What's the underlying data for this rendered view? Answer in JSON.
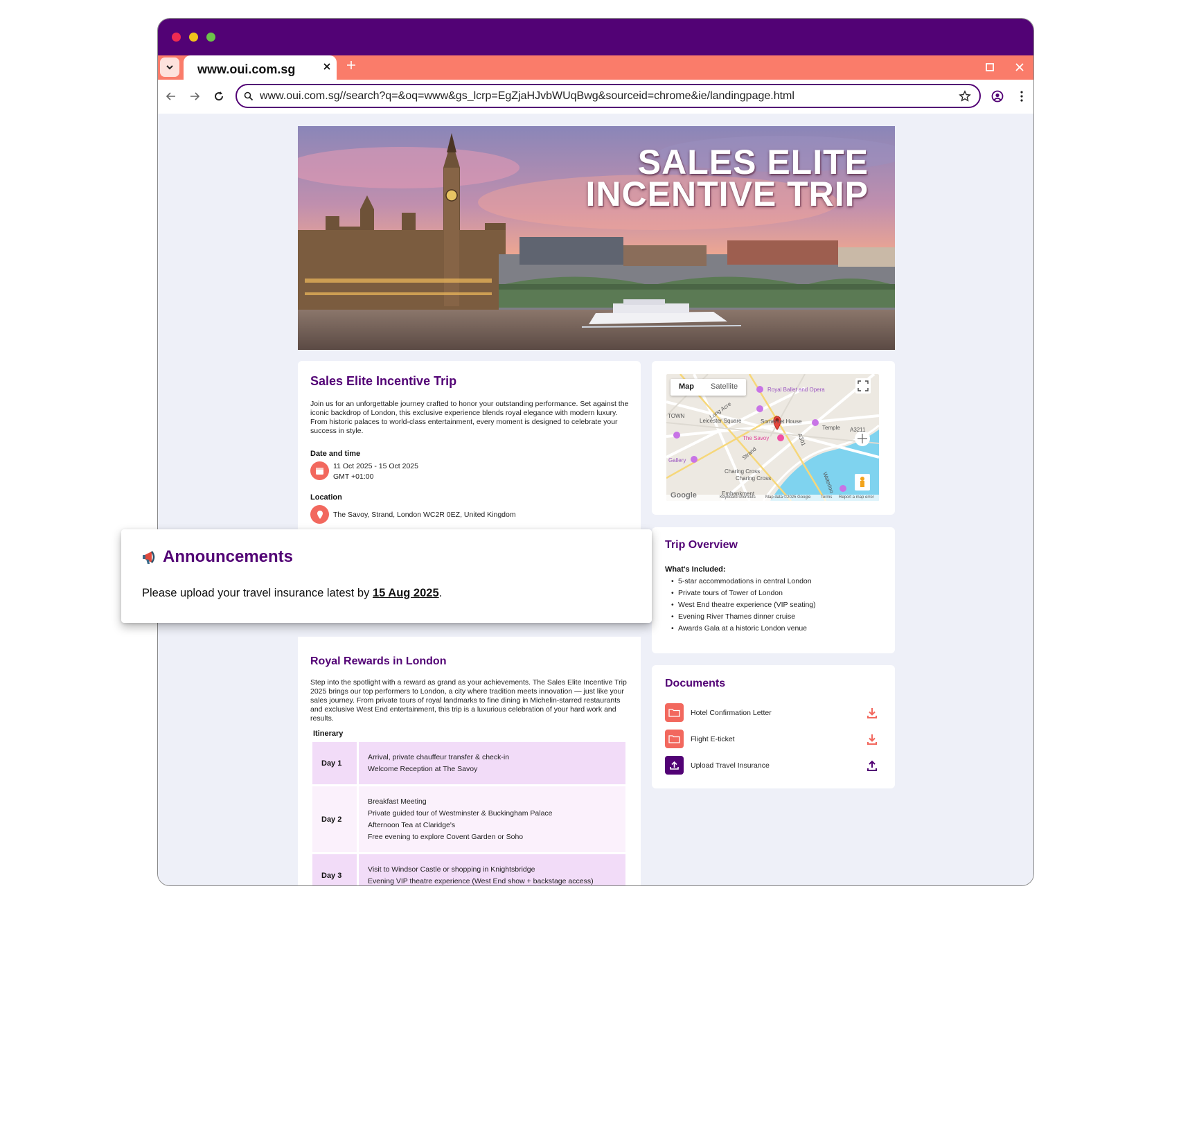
{
  "browser": {
    "tab_title": "www.oui.com.sg",
    "url": "www.oui.com.sg//search?q=&oq=www&gs_lcrp=EgZjaHJvbWUqBwg&sourceid=chrome&ie/landingpage.html"
  },
  "colors": {
    "brand": "#520275",
    "tabbar": "#fa7c6a",
    "accent": "#f2685e",
    "page_bg": "#eef0f8"
  },
  "hero": {
    "title_line1": "SALES ELITE",
    "title_line2": "INCENTIVE TRIP"
  },
  "event": {
    "title": "Sales Elite Incentive Trip",
    "description": "Join us for an unforgettable journey crafted to honor your outstanding performance. Set against the iconic backdrop of London, this exclusive experience blends royal elegance with modern luxury. From historic palaces to world-class entertainment, every moment is designed to celebrate your success in style.",
    "date_label": "Date and time",
    "date_range": "11 Oct 2025 - 15 Oct 2025",
    "timezone": "GMT +01:00",
    "location_label": "Location",
    "location": "The Savoy, Strand, London WC2R 0EZ, United Kingdom"
  },
  "map": {
    "tab_map": "Map",
    "tab_satellite": "Satellite",
    "labels": {
      "royal_ballet": "Royal Ballet and Opera",
      "leicester": "Leicester Square",
      "somerset": "Somerset House",
      "temple": "Temple",
      "a3211": "A3211",
      "savoy": "The Savoy",
      "gallery": "Gallery",
      "strand": "Strand",
      "charing_cross": "Charing Cross",
      "charing_cross2": "Charing Cross",
      "embankment": "Embankment",
      "a301": "A301",
      "waterloo": "Waterloo",
      "long_acre": "Long Acre",
      "town": "TOWN"
    },
    "google": "Google",
    "footer_shortcuts": "Keyboard shortcuts",
    "footer_data": "Map data ©2025 Google",
    "footer_terms": "Terms",
    "footer_report": "Report a map error"
  },
  "announcement": {
    "title": "Announcements",
    "text_before": "Please upload your travel insurance latest by",
    "deadline": "15 Aug 2025",
    "text_after": "."
  },
  "overview": {
    "title": "Trip Overview",
    "included_label": "What's Included:",
    "items": [
      "5-star accommodations in central London",
      "Private tours of Tower of London",
      "West End theatre experience (VIP seating)",
      "Evening River Thames dinner cruise",
      "Awards Gala at a historic London venue"
    ]
  },
  "documents": {
    "title": "Documents",
    "items": [
      {
        "name": "Hotel Confirmation Letter",
        "icon": "folder-icon",
        "action": "download-icon"
      },
      {
        "name": "Flight E-ticket",
        "icon": "folder-icon",
        "action": "download-icon"
      },
      {
        "name": "Upload Travel Insurance",
        "icon": "upload-icon",
        "action": "upload-icon"
      }
    ]
  },
  "rewards": {
    "title": "Royal Rewards in London",
    "description": "Step into the spotlight with a reward as grand as your achievements. The Sales Elite Incentive Trip 2025 brings our top performers to London, a city where tradition meets innovation — just like your sales journey. From private tours of royal landmarks to fine dining in Michelin-starred restaurants and exclusive West End entertainment, this trip is a luxurious celebration of your hard work and results.",
    "itinerary_label": "Itinerary",
    "days": [
      {
        "day": "Day 1",
        "activities": [
          "Arrival, private chauffeur transfer & check-in",
          "Welcome Reception at The Savoy"
        ]
      },
      {
        "day": "Day 2",
        "activities": [
          "Breakfast Meeting",
          "Private guided tour of Westminster & Buckingham Palace",
          "Afternoon Tea at Claridge's",
          "Free evening to explore Covent Garden or Soho"
        ]
      },
      {
        "day": "Day 3",
        "activities": [
          "Visit to Windsor Castle or shopping in Knightsbridge",
          "Evening VIP theatre experience (West End show + backstage access)"
        ]
      }
    ]
  }
}
